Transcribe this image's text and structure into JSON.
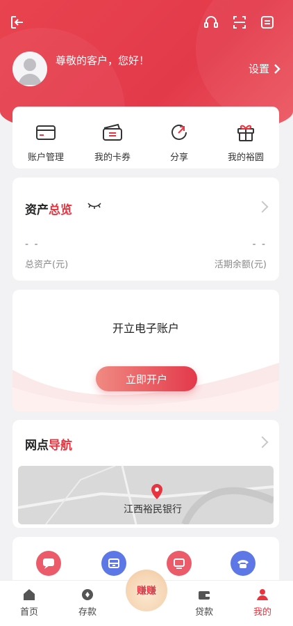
{
  "header": {
    "greeting": "尊敬的客户，您好！",
    "settings_label": "设置",
    "icons": [
      "exit-icon",
      "headset-icon",
      "scan-icon",
      "message-icon"
    ]
  },
  "quick_actions": [
    {
      "label": "账户管理",
      "icon": "card-icon"
    },
    {
      "label": "我的卡券",
      "icon": "coupon-icon"
    },
    {
      "label": "分享",
      "icon": "share-icon"
    },
    {
      "label": "我的裕圆",
      "icon": "gift-icon"
    }
  ],
  "assets": {
    "title_a": "资产",
    "title_b": "总览",
    "total_value": "- -",
    "total_label": "总资产(元)",
    "current_value": "- -",
    "current_label": "活期余额(元)"
  },
  "open_account": {
    "title": "开立电子账户",
    "button": "立即开户"
  },
  "navigation": {
    "title_a": "网点",
    "title_b": "导航",
    "map_label": "江西裕民银行"
  },
  "services": [
    {
      "icon": "chat-icon",
      "color": "#ec5b6a"
    },
    {
      "icon": "inbox-icon",
      "color": "#5d78e6"
    },
    {
      "icon": "screen-icon",
      "color": "#ec5b6a"
    },
    {
      "icon": "phone-icon",
      "color": "#5d78e6"
    }
  ],
  "tabbar": {
    "items": [
      {
        "label": "首页",
        "icon": "home-icon"
      },
      {
        "label": "存款",
        "icon": "deposit-icon"
      },
      {
        "label": "贷款",
        "icon": "wallet-icon"
      },
      {
        "label": "我的",
        "icon": "profile-icon"
      }
    ],
    "center_text": "赚赚",
    "active": "我的"
  },
  "colors": {
    "brand": "#e8343f",
    "accent_blue": "#5d78e6"
  }
}
